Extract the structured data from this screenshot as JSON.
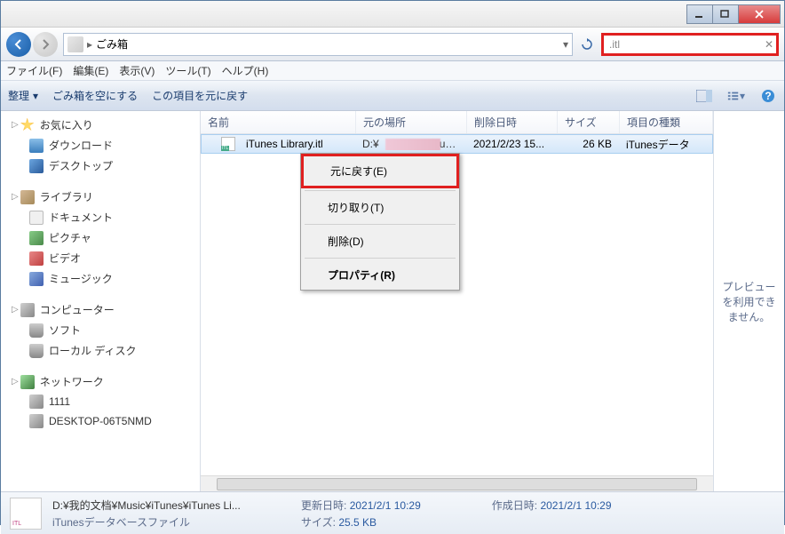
{
  "breadcrumb": {
    "location": "ごみ箱"
  },
  "search": {
    "value": ".itl"
  },
  "menubar": [
    "ファイル(F)",
    "編集(E)",
    "表示(V)",
    "ツール(T)",
    "ヘルプ(H)"
  ],
  "toolbar": {
    "organize": "整理",
    "empty": "ごみ箱を空にする",
    "restore": "この項目を元に戻す"
  },
  "columns": {
    "name": "名前",
    "location": "元の場所",
    "deleted": "削除日時",
    "size": "サイズ",
    "type": "項目の種類"
  },
  "file": {
    "name": "iTunes Library.itl",
    "location_prefix": "D:¥",
    "location_suffix": "us...",
    "deleted": "2021/2/23 15...",
    "size": "26 KB",
    "type": "iTunesデータ"
  },
  "context_menu": {
    "restore": "元に戻す(E)",
    "cut": "切り取り(T)",
    "delete": "削除(D)",
    "properties": "プロパティ(R)"
  },
  "sidebar": {
    "favorites": {
      "label": "お気に入り",
      "items": [
        "ダウンロード",
        "デスクトップ"
      ]
    },
    "library": {
      "label": "ライブラリ",
      "items": [
        "ドキュメント",
        "ピクチャ",
        "ビデオ",
        "ミュージック"
      ]
    },
    "computer": {
      "label": "コンピューター",
      "items": [
        "ソフト",
        "ローカル ディスク"
      ]
    },
    "network": {
      "label": "ネットワーク",
      "items": [
        "1111",
        "DESKTOP-06T5NMD"
      ]
    }
  },
  "preview": {
    "text": "プレビューを利用できません。"
  },
  "statusbar": {
    "path": "D:¥我的文档¥Music¥iTunes¥iTunes Li...",
    "filetype": "iTunesデータベースファイル",
    "modified_label": "更新日時:",
    "modified": "2021/2/1 10:29",
    "created_label": "作成日時:",
    "created": "2021/2/1 10:29",
    "size_label": "サイズ:",
    "size": "25.5 KB"
  }
}
